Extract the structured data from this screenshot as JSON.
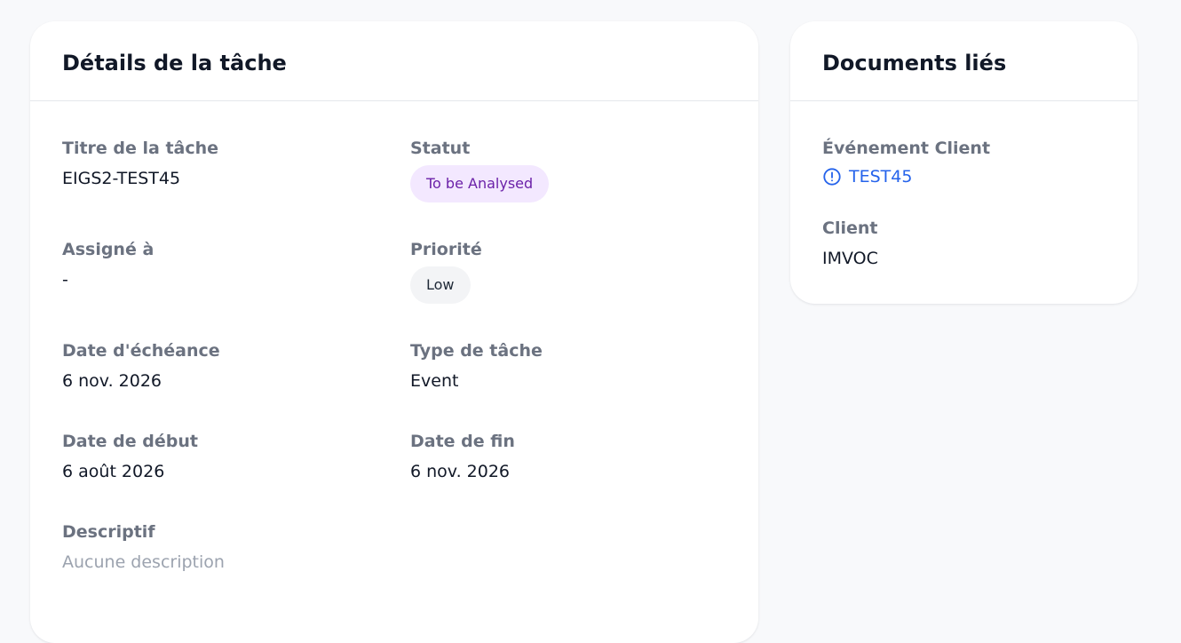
{
  "details": {
    "title": "Détails de la tâche",
    "task_title_label": "Titre de la tâche",
    "task_title_value": "EIGS2-TEST45",
    "status_label": "Statut",
    "status_value": "To be Analysed",
    "assigned_label": "Assigné à",
    "assigned_value": "-",
    "priority_label": "Priorité",
    "priority_value": "Low",
    "due_date_label": "Date d'échéance",
    "due_date_value": "6 nov. 2026",
    "task_type_label": "Type de tâche",
    "task_type_value": "Event",
    "start_date_label": "Date de début",
    "start_date_value": "6 août 2026",
    "end_date_label": "Date de fin",
    "end_date_value": "6 nov. 2026",
    "description_label": "Descriptif",
    "description_value": "Aucune description"
  },
  "documents": {
    "title": "Documents liés",
    "event_label": "Événement Client",
    "event_link": "TEST45",
    "event_icon": "alert-circle-icon",
    "client_label": "Client",
    "client_value": "IMVOC"
  },
  "colors": {
    "status_badge_bg": "#f3e8ff",
    "status_badge_text": "#6b21a8",
    "priority_badge_bg": "#f3f4f6",
    "link": "#2563eb",
    "label": "#6b7280"
  }
}
